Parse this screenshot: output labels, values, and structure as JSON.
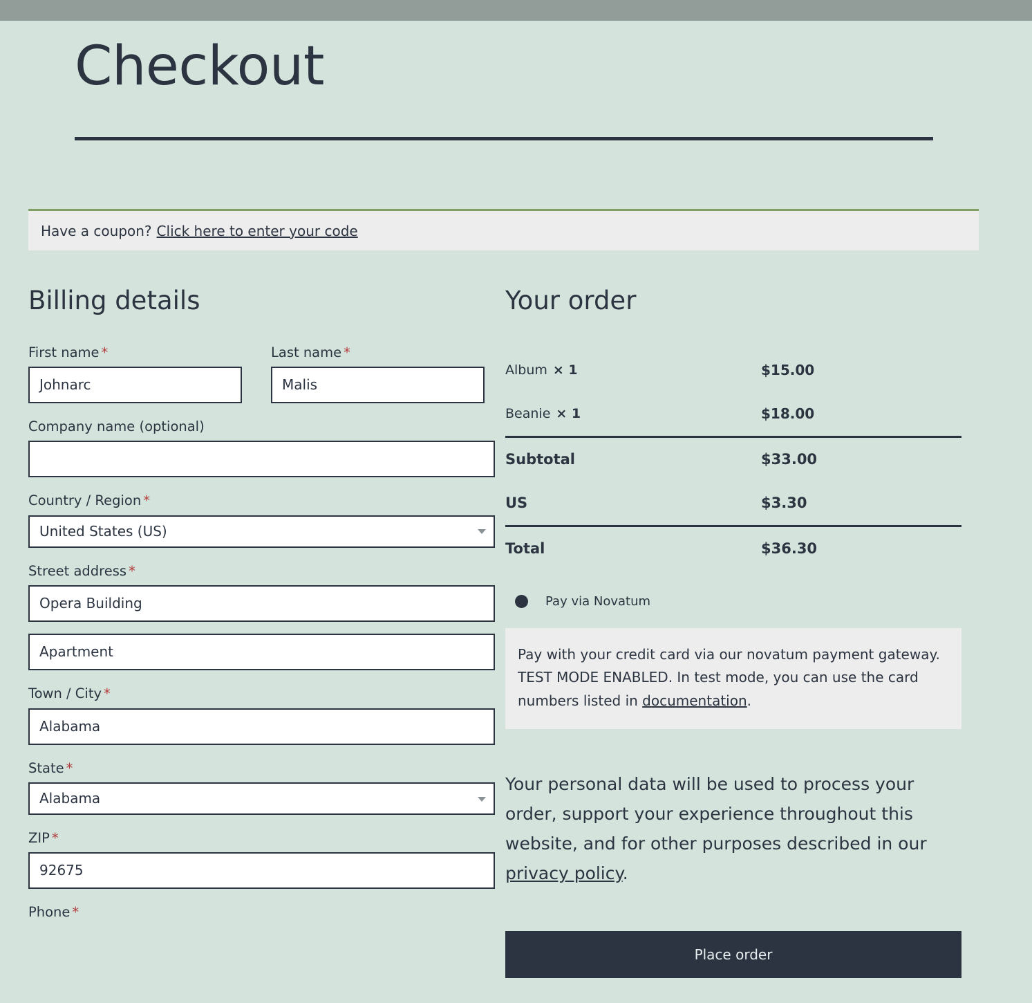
{
  "page": {
    "title": "Checkout"
  },
  "coupon": {
    "prompt": "Have a coupon?",
    "link_label": "Click here to enter your code"
  },
  "billing": {
    "heading": "Billing details",
    "required_mark": "*",
    "fields": {
      "first_name": {
        "label": "First name",
        "value": "Johnarc",
        "required": true
      },
      "last_name": {
        "label": "Last name",
        "value": "Malis",
        "required": true
      },
      "company": {
        "label": "Company name (optional)",
        "value": "",
        "required": false
      },
      "country": {
        "label": "Country / Region",
        "value": "United States (US)",
        "required": true
      },
      "street_address": {
        "label": "Street address",
        "value": "Opera Building",
        "required": true
      },
      "street_address_2": {
        "label": "",
        "value": "Apartment",
        "required": false
      },
      "city": {
        "label": "Town / City",
        "value": "Alabama",
        "required": true
      },
      "state": {
        "label": "State",
        "value": "Alabama",
        "required": true
      },
      "zip": {
        "label": "ZIP",
        "value": "92675",
        "required": true
      },
      "phone": {
        "label": "Phone",
        "value": "",
        "required": true
      }
    }
  },
  "order": {
    "heading": "Your order",
    "line_items": [
      {
        "name": "Album",
        "qty": "× 1",
        "amount": "$15.00"
      },
      {
        "name": "Beanie",
        "qty": "× 1",
        "amount": "$18.00"
      }
    ],
    "subtotal": {
      "label": "Subtotal",
      "amount": "$33.00"
    },
    "tax": {
      "label": "US",
      "amount": "$3.30"
    },
    "total": {
      "label": "Total",
      "amount": "$36.30"
    }
  },
  "payment": {
    "method_label": "Pay via Novatum",
    "description_before": "Pay with your credit card via our novatum payment gateway. TEST MODE ENABLED. In test mode, you can use the card numbers listed in ",
    "description_link": "documentation",
    "description_after": "."
  },
  "privacy": {
    "text_before": "Your personal data will be used to process your order, support your experience throughout this website, and for other purposes described in our ",
    "link_label": "privacy policy",
    "text_after": "."
  },
  "actions": {
    "place_order": "Place order"
  },
  "colors": {
    "topbar": "#929d99",
    "background": "#d4e4dc",
    "ink": "#2b3440",
    "coupon_bg": "#ededed",
    "coupon_border": "#7f9f63",
    "required": "#b23b3b",
    "button": "#2b3440"
  }
}
